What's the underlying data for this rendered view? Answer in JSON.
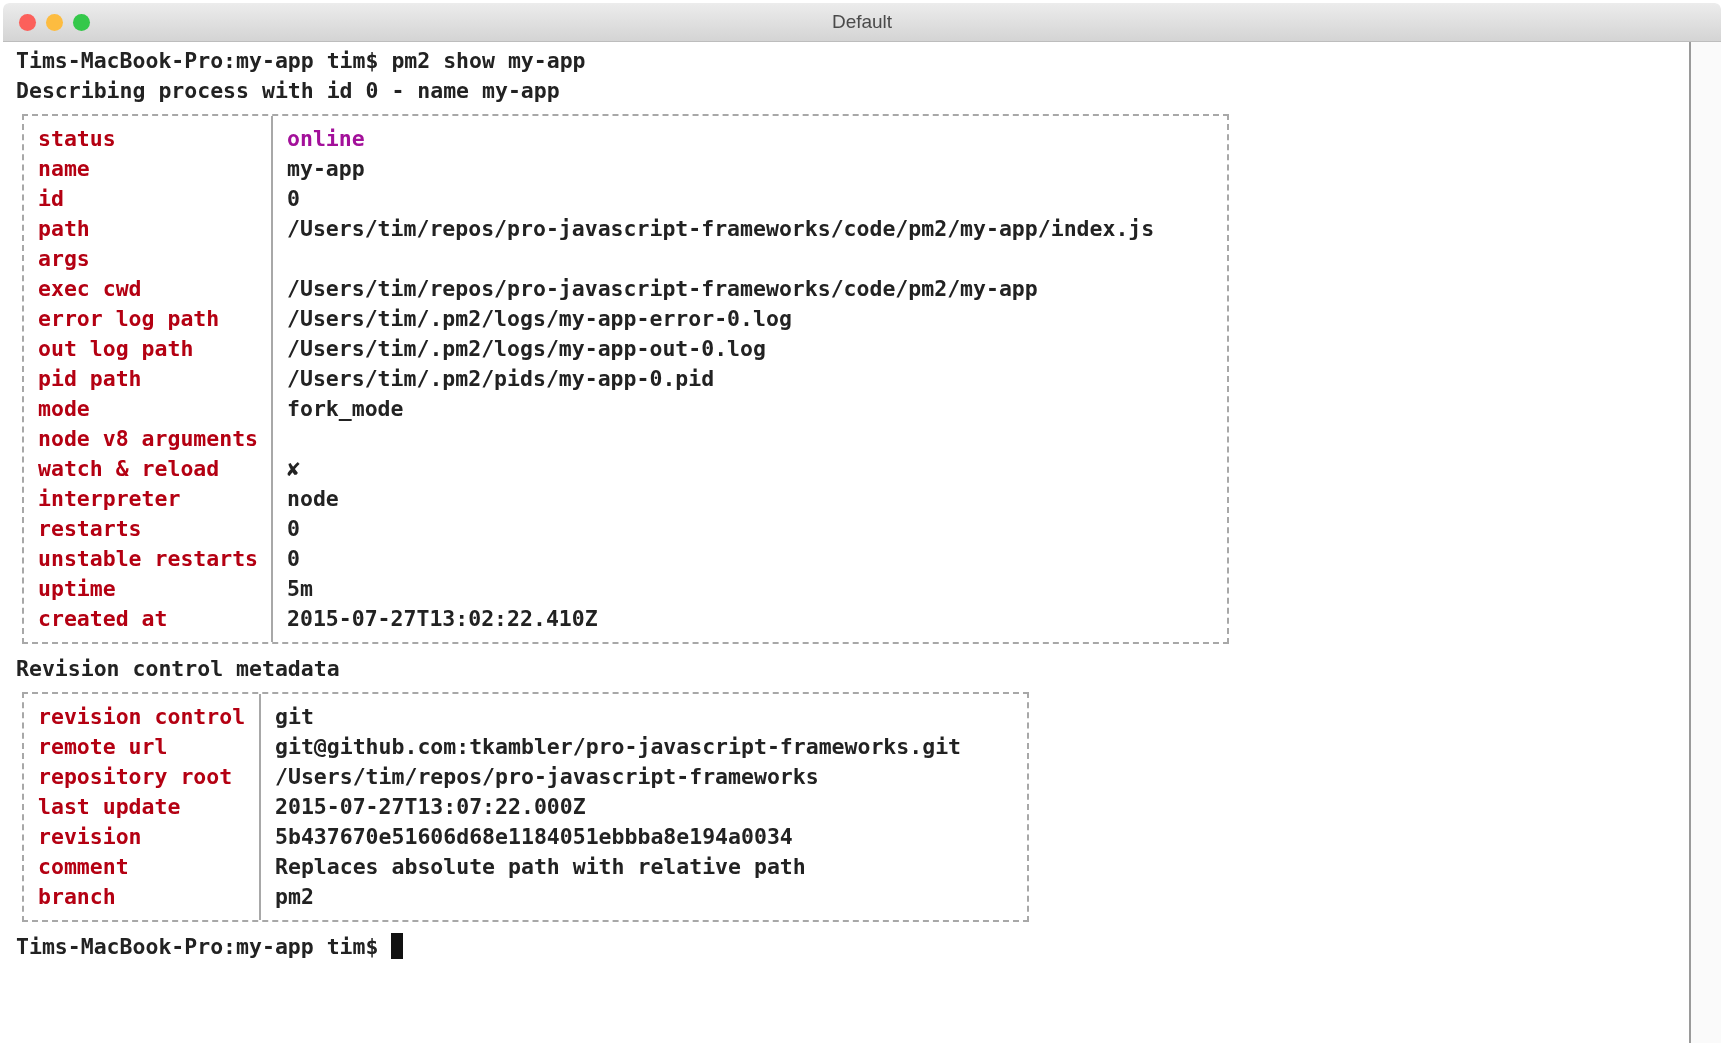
{
  "window": {
    "title": "Default"
  },
  "terminal": {
    "lines_before": [
      "Tims-MacBook-Pro:my-app tim$ pm2 show my-app",
      "Describing process with id 0 - name my-app"
    ],
    "process_table": [
      {
        "key": "status",
        "value": "online",
        "color": "#a3109a"
      },
      {
        "key": "name",
        "value": "my-app"
      },
      {
        "key": "id",
        "value": "0"
      },
      {
        "key": "path",
        "value": "/Users/tim/repos/pro-javascript-frameworks/code/pm2/my-app/index.js"
      },
      {
        "key": "args"
      },
      {
        "key": "exec cwd",
        "value": "/Users/tim/repos/pro-javascript-frameworks/code/pm2/my-app"
      },
      {
        "key": "error log path",
        "value": "/Users/tim/.pm2/logs/my-app-error-0.log"
      },
      {
        "key": "out log path",
        "value": "/Users/tim/.pm2/logs/my-app-out-0.log"
      },
      {
        "key": "pid path",
        "value": "/Users/tim/.pm2/pids/my-app-0.pid"
      },
      {
        "key": "mode",
        "value": "fork_mode"
      },
      {
        "key": "node v8 arguments"
      },
      {
        "key": "watch & reload",
        "value": "✘"
      },
      {
        "key": "interpreter",
        "value": "node"
      },
      {
        "key": "restarts",
        "value": "0"
      },
      {
        "key": "unstable restarts",
        "value": "0"
      },
      {
        "key": "uptime",
        "value": "5m"
      },
      {
        "key": "created at",
        "value": "2015-07-27T13:02:22.410Z"
      }
    ],
    "section_heading": "Revision control metadata",
    "revision_table": [
      {
        "key": "revision control",
        "value": "git"
      },
      {
        "key": "remote url",
        "value": "git@github.com:tkambler/pro-javascript-frameworks.git"
      },
      {
        "key": "repository root",
        "value": "/Users/tim/repos/pro-javascript-frameworks"
      },
      {
        "key": "last update",
        "value": "2015-07-27T13:07:22.000Z"
      },
      {
        "key": "revision",
        "value": "5b437670e51606d68e1184051ebbba8e194a0034"
      },
      {
        "key": "comment",
        "value": "Replaces absolute path with relative path"
      },
      {
        "key": "branch",
        "value": "pm2"
      }
    ],
    "prompt": "Tims-MacBook-Pro:my-app tim$"
  }
}
